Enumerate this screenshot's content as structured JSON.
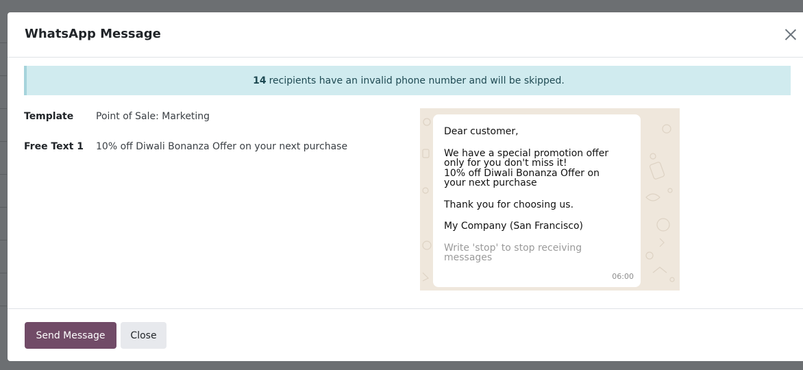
{
  "dialog": {
    "title": "WhatsApp Message",
    "close_icon": "close-icon"
  },
  "alert": {
    "count": "14",
    "message": "recipients have an invalid phone number and will be skipped."
  },
  "fields": [
    {
      "label": "Template",
      "value": "Point of Sale: Marketing"
    },
    {
      "label": "Free Text 1",
      "value": "10% off Diwali Bonanza Offer on your next purchase"
    }
  ],
  "preview": {
    "greeting": "Dear customer,",
    "body_lines": [
      "We have a special promotion offer",
      "only for you don't miss it!",
      "10% off Diwali Bonanza Offer on",
      "your next purchase"
    ],
    "thanks": "Thank you for choosing us.",
    "signature": "My Company (San Francisco)",
    "footer_lines": [
      "Write 'stop' to stop receiving",
      "messages"
    ],
    "time": "06:00"
  },
  "footer": {
    "send_label": "Send Message",
    "close_label": "Close"
  },
  "colors": {
    "primary": "#714b67",
    "alert_bg": "#d0ebef",
    "chat_bg": "#efe7dc"
  }
}
